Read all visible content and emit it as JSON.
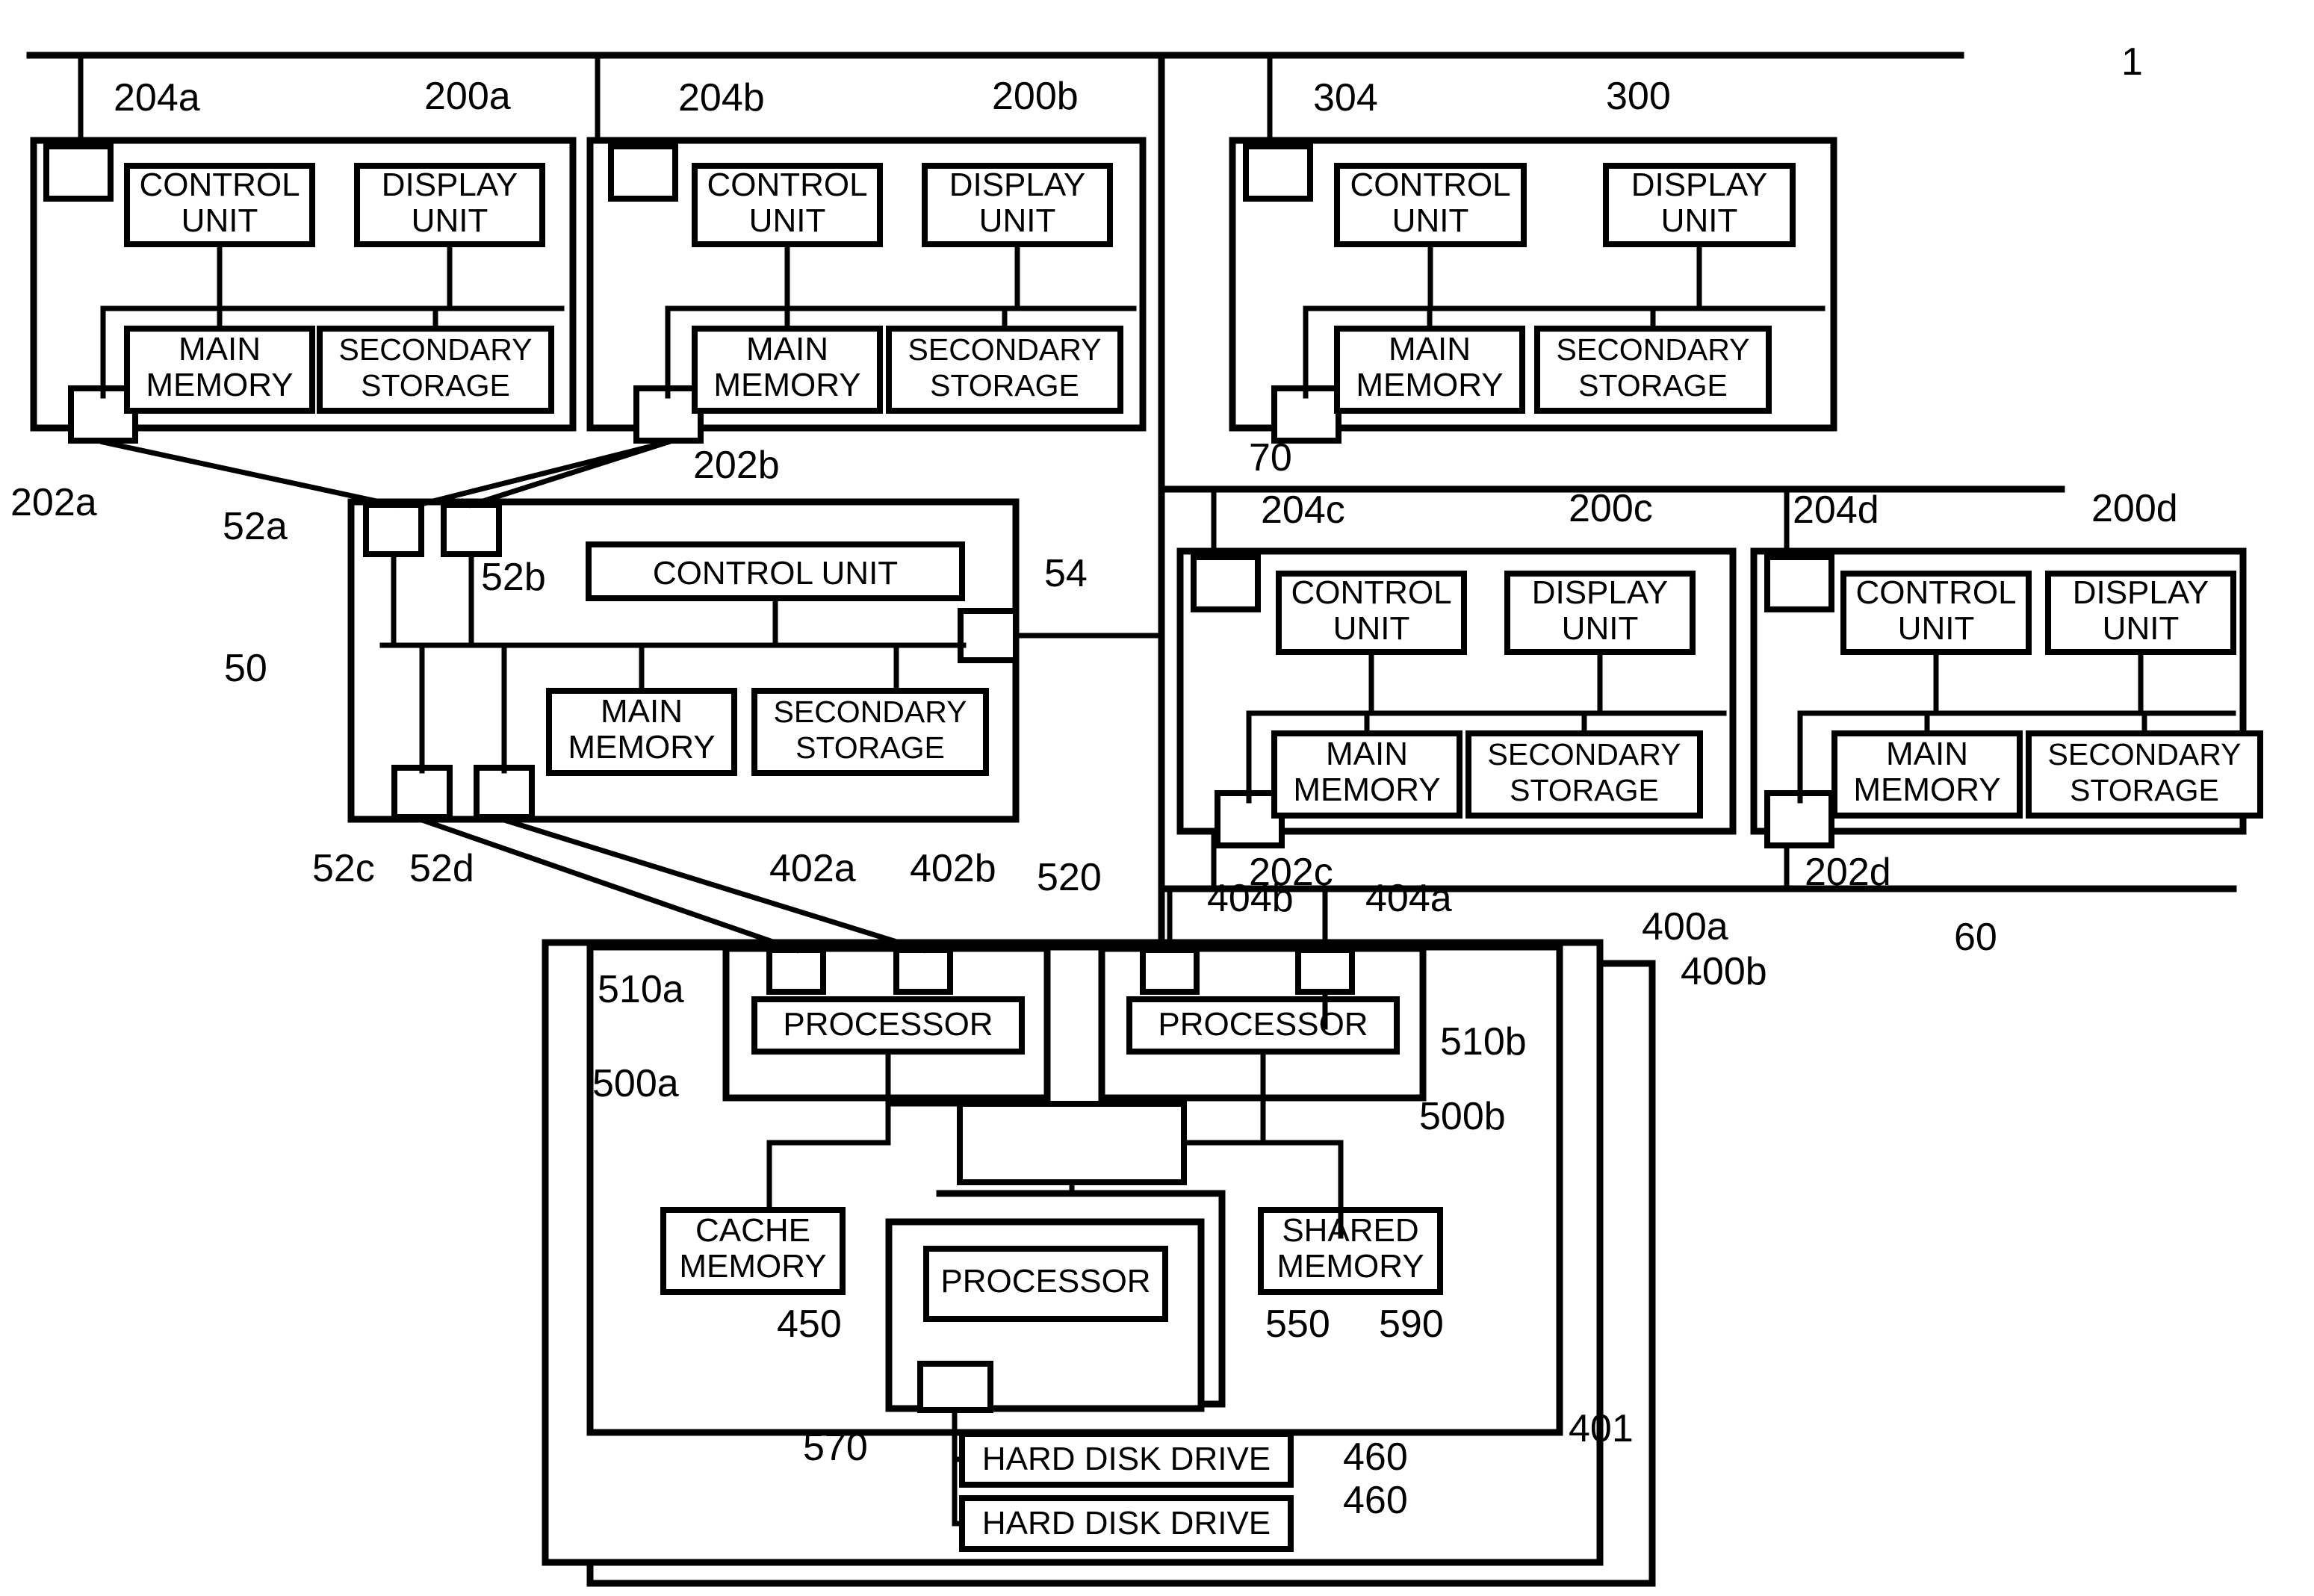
{
  "figure": {
    "ref_top": "1",
    "networks": [
      {
        "id": "net-70",
        "label": "70"
      },
      {
        "id": "net-60",
        "label": "60"
      }
    ]
  },
  "computers": [
    {
      "key": "200a",
      "ref": "200a",
      "port_top": "204a",
      "port_bottom": "202a",
      "blocks": [
        "CONTROL UNIT",
        "DISPLAY UNIT",
        "MAIN MEMORY",
        "SECONDARY STORAGE"
      ]
    },
    {
      "key": "200b",
      "ref": "200b",
      "port_top": "204b",
      "port_bottom": "202b",
      "blocks": [
        "CONTROL UNIT",
        "DISPLAY UNIT",
        "MAIN MEMORY",
        "SECONDARY STORAGE"
      ]
    },
    {
      "key": "300",
      "ref": "300",
      "port_top": "304",
      "port_bottom": "",
      "blocks": [
        "CONTROL UNIT",
        "DISPLAY UNIT",
        "MAIN MEMORY",
        "SECONDARY STORAGE"
      ]
    },
    {
      "key": "200c",
      "ref": "200c",
      "port_top": "204c",
      "port_bottom": "202c",
      "blocks": [
        "CONTROL UNIT",
        "DISPLAY UNIT",
        "MAIN MEMORY",
        "SECONDARY STORAGE"
      ]
    },
    {
      "key": "200d",
      "ref": "200d",
      "port_top": "204d",
      "port_bottom": "202d",
      "blocks": [
        "CONTROL UNIT",
        "DISPLAY UNIT",
        "MAIN MEMORY",
        "SECONDARY STORAGE"
      ]
    }
  ],
  "server": {
    "ref": "50",
    "ports": [
      "52a",
      "52b",
      "52c",
      "52d"
    ],
    "port_right": "54",
    "blocks": [
      "CONTROL UNIT",
      "MAIN MEMORY",
      "SECONDARY STORAGE"
    ]
  },
  "storage": {
    "ref_front": "400a",
    "ref_back": "400b",
    "ref_inner": "401",
    "ports": [
      "402a",
      "402b",
      "404b",
      "404a"
    ],
    "switch_ref": "520",
    "controllers": [
      {
        "ref_unit": "500a",
        "ref_proc": "510a",
        "label": "PROCESSOR"
      },
      {
        "ref_unit": "500b",
        "ref_proc": "510b",
        "label": "PROCESSOR"
      }
    ],
    "cache_memory": {
      "label": "CACHE MEMORY",
      "ref": "450"
    },
    "shared_memory": {
      "label": "SHARED MEMORY",
      "ref": "590"
    },
    "disk_controller": {
      "label": "PROCESSOR",
      "ref": "550",
      "port_ref": "570"
    },
    "drives": [
      {
        "label": "HARD DISK DRIVE",
        "ref": "460"
      },
      {
        "label": "HARD DISK DRIVE",
        "ref": "460"
      }
    ]
  },
  "labels": {
    "control_unit": "CONTROL UNIT",
    "display_unit": "DISPLAY UNIT",
    "main_memory": "MAIN MEMORY",
    "secondary_storage": "SECONDARY STORAGE",
    "processor": "PROCESSOR",
    "cache_memory": "CACHE MEMORY",
    "shared_memory": "SHARED MEMORY",
    "hard_disk_drive": "HARD DISK DRIVE"
  },
  "colors": {
    "ink": "#000000",
    "paper": "#ffffff"
  }
}
